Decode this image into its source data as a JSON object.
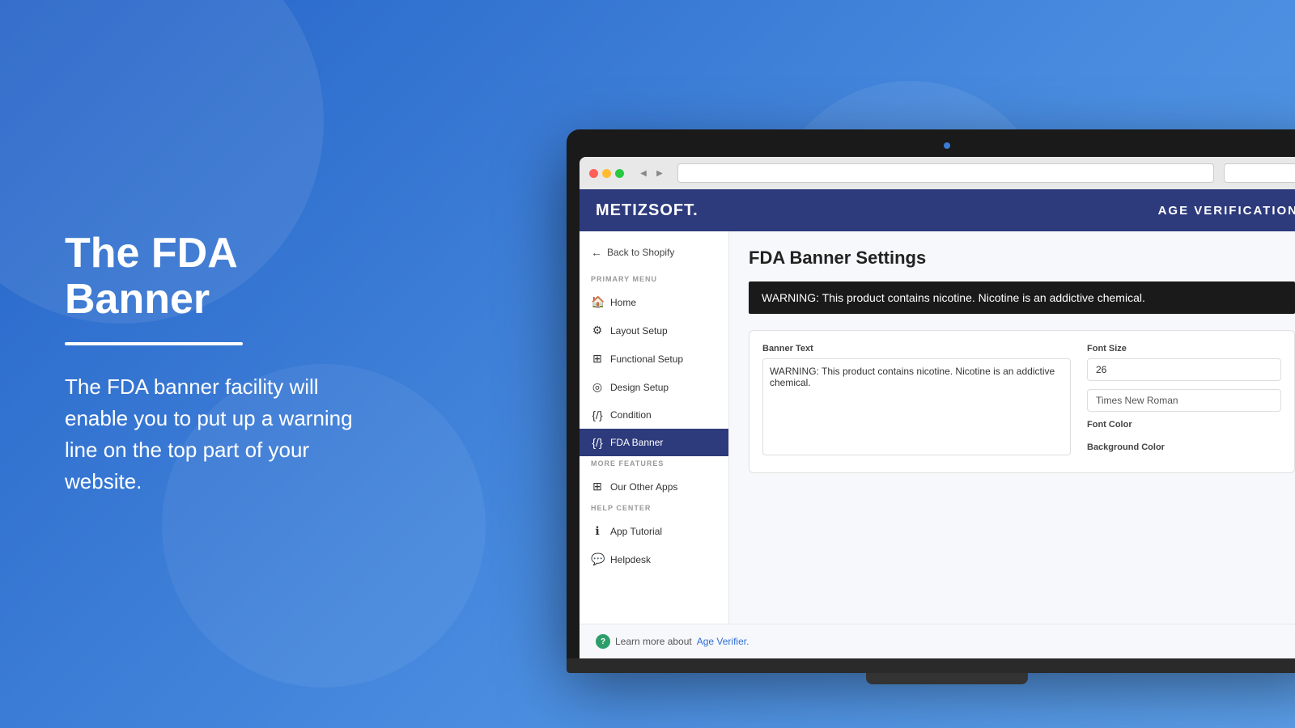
{
  "background": {
    "color": "#2d6fd4"
  },
  "left_panel": {
    "title": "The FDA Banner",
    "description": "The FDA banner facility will enable you to put up a warning line on the top part of your website."
  },
  "browser": {
    "traffic_lights": [
      "red",
      "yellow",
      "green"
    ]
  },
  "app": {
    "logo": "METIZSOFT.",
    "header_title": "AGE VERIFICATION",
    "back_link": "Back to Shopify",
    "primary_menu_label": "PRIMARY MENU",
    "menu_items": [
      {
        "label": "Home",
        "icon": "🏠",
        "active": false
      },
      {
        "label": "Layout Setup",
        "icon": "⚙️",
        "active": false
      },
      {
        "label": "Functional Setup",
        "icon": "⊞",
        "active": false
      },
      {
        "label": "Design Setup",
        "icon": "👁",
        "active": false
      },
      {
        "label": "Condition",
        "icon": "{/}",
        "active": false
      },
      {
        "label": "FDA Banner",
        "icon": "{/}",
        "active": true
      }
    ],
    "more_features_label": "MORE FEATURES",
    "more_features_items": [
      {
        "label": "Our Other Apps",
        "icon": "⊞"
      }
    ],
    "help_center_label": "HELP CENTER",
    "help_items": [
      {
        "label": "App Tutorial",
        "icon": "ℹ"
      },
      {
        "label": "Helpdesk",
        "icon": "💬"
      }
    ],
    "page_title": "FDA Banner Settings",
    "warning_text": "WARNING: This product contains nicotine. Nicotine is an addictive chemical.",
    "form": {
      "banner_text_label": "Banner Text",
      "banner_text_value": "WARNING: This product contains nicotine. Nicotine is an addictive chemical.",
      "font_size_label": "Font Size",
      "font_size_value": "26",
      "font_family_value": "Times New Roman",
      "font_color_label": "Font Color",
      "background_color_label": "Background Color"
    },
    "learn_more_text": "Learn more about ",
    "age_verifier_link": "Age Verifier."
  }
}
